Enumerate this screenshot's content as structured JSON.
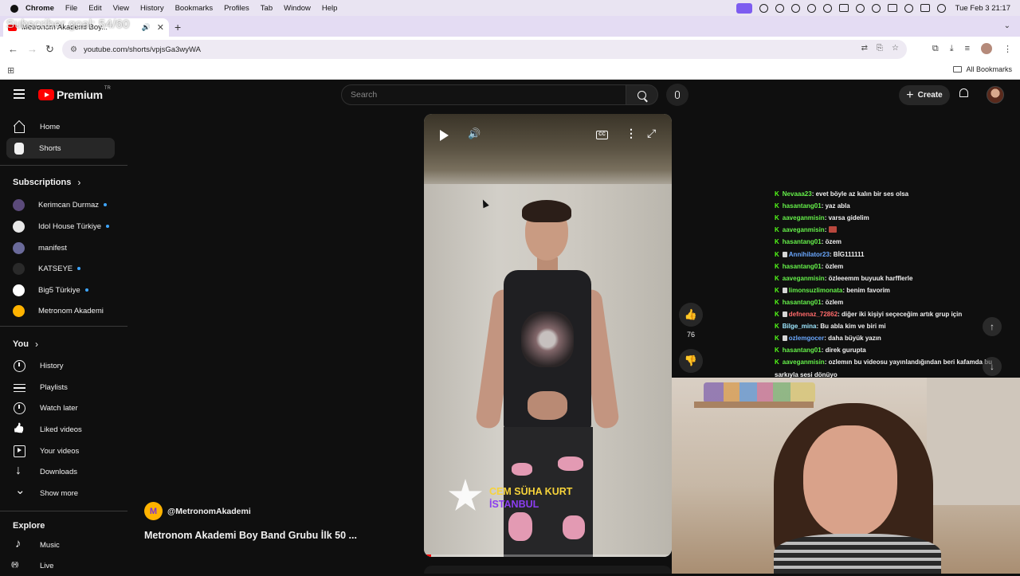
{
  "menubar": {
    "app": "Chrome",
    "items": [
      "File",
      "Edit",
      "View",
      "History",
      "Bookmarks",
      "Profiles",
      "Tab",
      "Window",
      "Help"
    ],
    "clock": "Tue Feb 3  21:17"
  },
  "overlay": {
    "sub_goal": "Subscriber goal: 54/60"
  },
  "tab": {
    "title": "Metronom Akademi Boy..."
  },
  "toolbar": {
    "url": "youtube.com/shorts/vpjsGa3wyWA"
  },
  "bookmarks": {
    "all_label": "All Bookmarks"
  },
  "masthead": {
    "logo_text": "Premium",
    "country": "TR",
    "search_placeholder": "Search",
    "create_label": "Create"
  },
  "guide": {
    "home": "Home",
    "shorts": "Shorts",
    "subscriptions_title": "Subscriptions",
    "subscriptions": [
      {
        "name": "Kerimcan Durmaz",
        "color": "#5b4a7a",
        "new": true
      },
      {
        "name": "Idol House Türkiye",
        "color": "#e8e8e8",
        "new": true
      },
      {
        "name": "manifest",
        "color": "#6a6a9a",
        "new": false
      },
      {
        "name": "KATSEYE",
        "color": "#2a2a2a",
        "new": true
      },
      {
        "name": "Big5 Türkiye",
        "color": "#ffffff",
        "new": true
      },
      {
        "name": "Metronom Akademi",
        "color": "#ffb300",
        "new": false
      }
    ],
    "you_title": "You",
    "you_items": [
      "History",
      "Playlists",
      "Watch later",
      "Liked videos",
      "Your videos",
      "Downloads",
      "Show more"
    ],
    "explore_title": "Explore",
    "explore_items": [
      "Music",
      "Live"
    ]
  },
  "player": {
    "overlay_line1": "CEM SÜHA KURT",
    "overlay_line2": "İSTANBUL",
    "progress": 0.03
  },
  "actions": {
    "like_count": "76"
  },
  "channel": {
    "avatar_letter": "M",
    "handle": "@MetronomAkademi"
  },
  "video": {
    "title": "Metronom Akademi Boy Band Grubu İlk 50 ..."
  },
  "chat": [
    {
      "user": "Nevaaa23",
      "msg": ": evet böyle az kalın bir ses olsa",
      "style": ""
    },
    {
      "user": "hasantang01",
      "msg": ": yaz abla",
      "style": ""
    },
    {
      "user": "aaveganmisin",
      "msg": ": varsa gidelim",
      "style": ""
    },
    {
      "user": "aaveganmisin",
      "msg": ": ",
      "style": "",
      "emoji": true
    },
    {
      "user": "hasantang01",
      "msg": ": özem",
      "style": ""
    },
    {
      "user": "Annihilator23",
      "msg": ": BİG111111",
      "style": "blue",
      "badge": true
    },
    {
      "user": "hasantang01",
      "msg": ": özlem",
      "style": ""
    },
    {
      "user": "aaveganmisin",
      "msg": ": özleeemm buyuuk harfflerle",
      "style": ""
    },
    {
      "user": "limonsuzlimonata",
      "msg": ": benim favorim",
      "style": "",
      "badge": true
    },
    {
      "user": "hasantang01",
      "msg": ": özlem",
      "style": ""
    },
    {
      "user": "defnenaz_72862",
      "msg": ": diğer iki kişiyi seçeceğim artık grup için",
      "style": "red",
      "badge": true
    },
    {
      "user": "Bilge_mina",
      "msg": ": Bu abla kim ve biri mi",
      "style": "cyan"
    },
    {
      "user": "ozlemgocer",
      "msg": ": daha büyük yazın",
      "style": "blue",
      "badge": true
    },
    {
      "user": "hasantang01",
      "msg": ": direk gurupta",
      "style": ""
    },
    {
      "user": "aaveganmisin",
      "msg": ": ozlemın bu videosu yayınlandığından beri kafamda bu",
      "style": ""
    },
    {
      "user": "",
      "msg": "sarkıyla sesi dönüyo",
      "style": ""
    }
  ]
}
